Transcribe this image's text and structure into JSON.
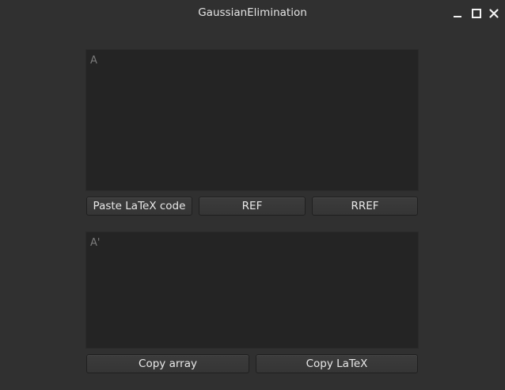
{
  "window": {
    "title": "GaussianElimination",
    "controls": [
      "minimize-icon",
      "maximize-icon",
      "close-icon"
    ]
  },
  "input": {
    "placeholder": "A",
    "value": ""
  },
  "actions": {
    "paste_label": "Paste LaTeX code",
    "ref_label": "REF",
    "rref_label": "RREF"
  },
  "output": {
    "placeholder": "A'",
    "value": ""
  },
  "copy_actions": {
    "copy_array_label": "Copy array",
    "copy_latex_label": "Copy LaTeX"
  },
  "colors": {
    "background": "#303030",
    "text_area": "#242424",
    "button": "#383838",
    "text": "#e8e8e8",
    "placeholder": "#7c7c7c"
  }
}
